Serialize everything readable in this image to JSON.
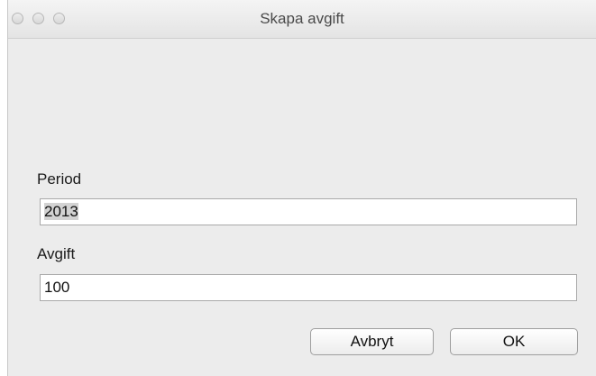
{
  "window": {
    "title": "Skapa avgift",
    "controls": [
      "close-button",
      "minimize-button",
      "zoom-button"
    ]
  },
  "form": {
    "period_label": "Period",
    "period_value": "2013",
    "fee_label": "Avgift",
    "fee_value": "100"
  },
  "buttons": {
    "cancel_label": "Avbryt",
    "ok_label": "OK"
  }
}
